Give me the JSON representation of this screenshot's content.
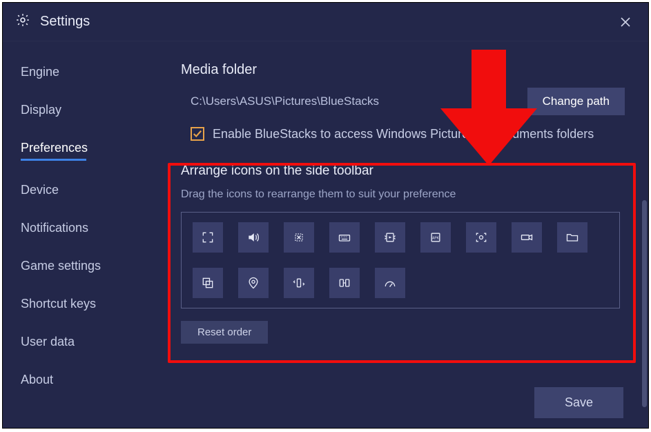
{
  "window": {
    "title": "Settings"
  },
  "sidebar": {
    "items": [
      {
        "label": "Engine"
      },
      {
        "label": "Display"
      },
      {
        "label": "Preferences",
        "active": true
      },
      {
        "label": "Device"
      },
      {
        "label": "Notifications"
      },
      {
        "label": "Game settings"
      },
      {
        "label": "Shortcut keys"
      },
      {
        "label": "User data"
      },
      {
        "label": "About"
      }
    ]
  },
  "media": {
    "title": "Media folder",
    "path": "C:\\Users\\ASUS\\Pictures\\BlueStacks",
    "change_path_label": "Change path",
    "enable_access_label": "Enable BlueStacks to access Windows Pictures & Documents folders",
    "enable_access_checked": true
  },
  "arrange": {
    "title": "Arrange icons on the side toolbar",
    "subtitle": "Drag the icons to rearrange them to suit your preference",
    "icons": [
      "fullscreen-icon",
      "volume-icon",
      "shake-icon",
      "keyboard-icon",
      "media-folder-icon",
      "install-apk-icon",
      "screenshot-icon",
      "record-icon",
      "folder-icon",
      "multi-instance-icon",
      "location-icon",
      "rotate-icon",
      "sync-icon",
      "speedometer-icon"
    ],
    "reset_label": "Reset order"
  },
  "footer": {
    "save_label": "Save"
  },
  "annotation": {
    "arrow_color": "#f10d0d",
    "box_color": "#f10d0d"
  }
}
